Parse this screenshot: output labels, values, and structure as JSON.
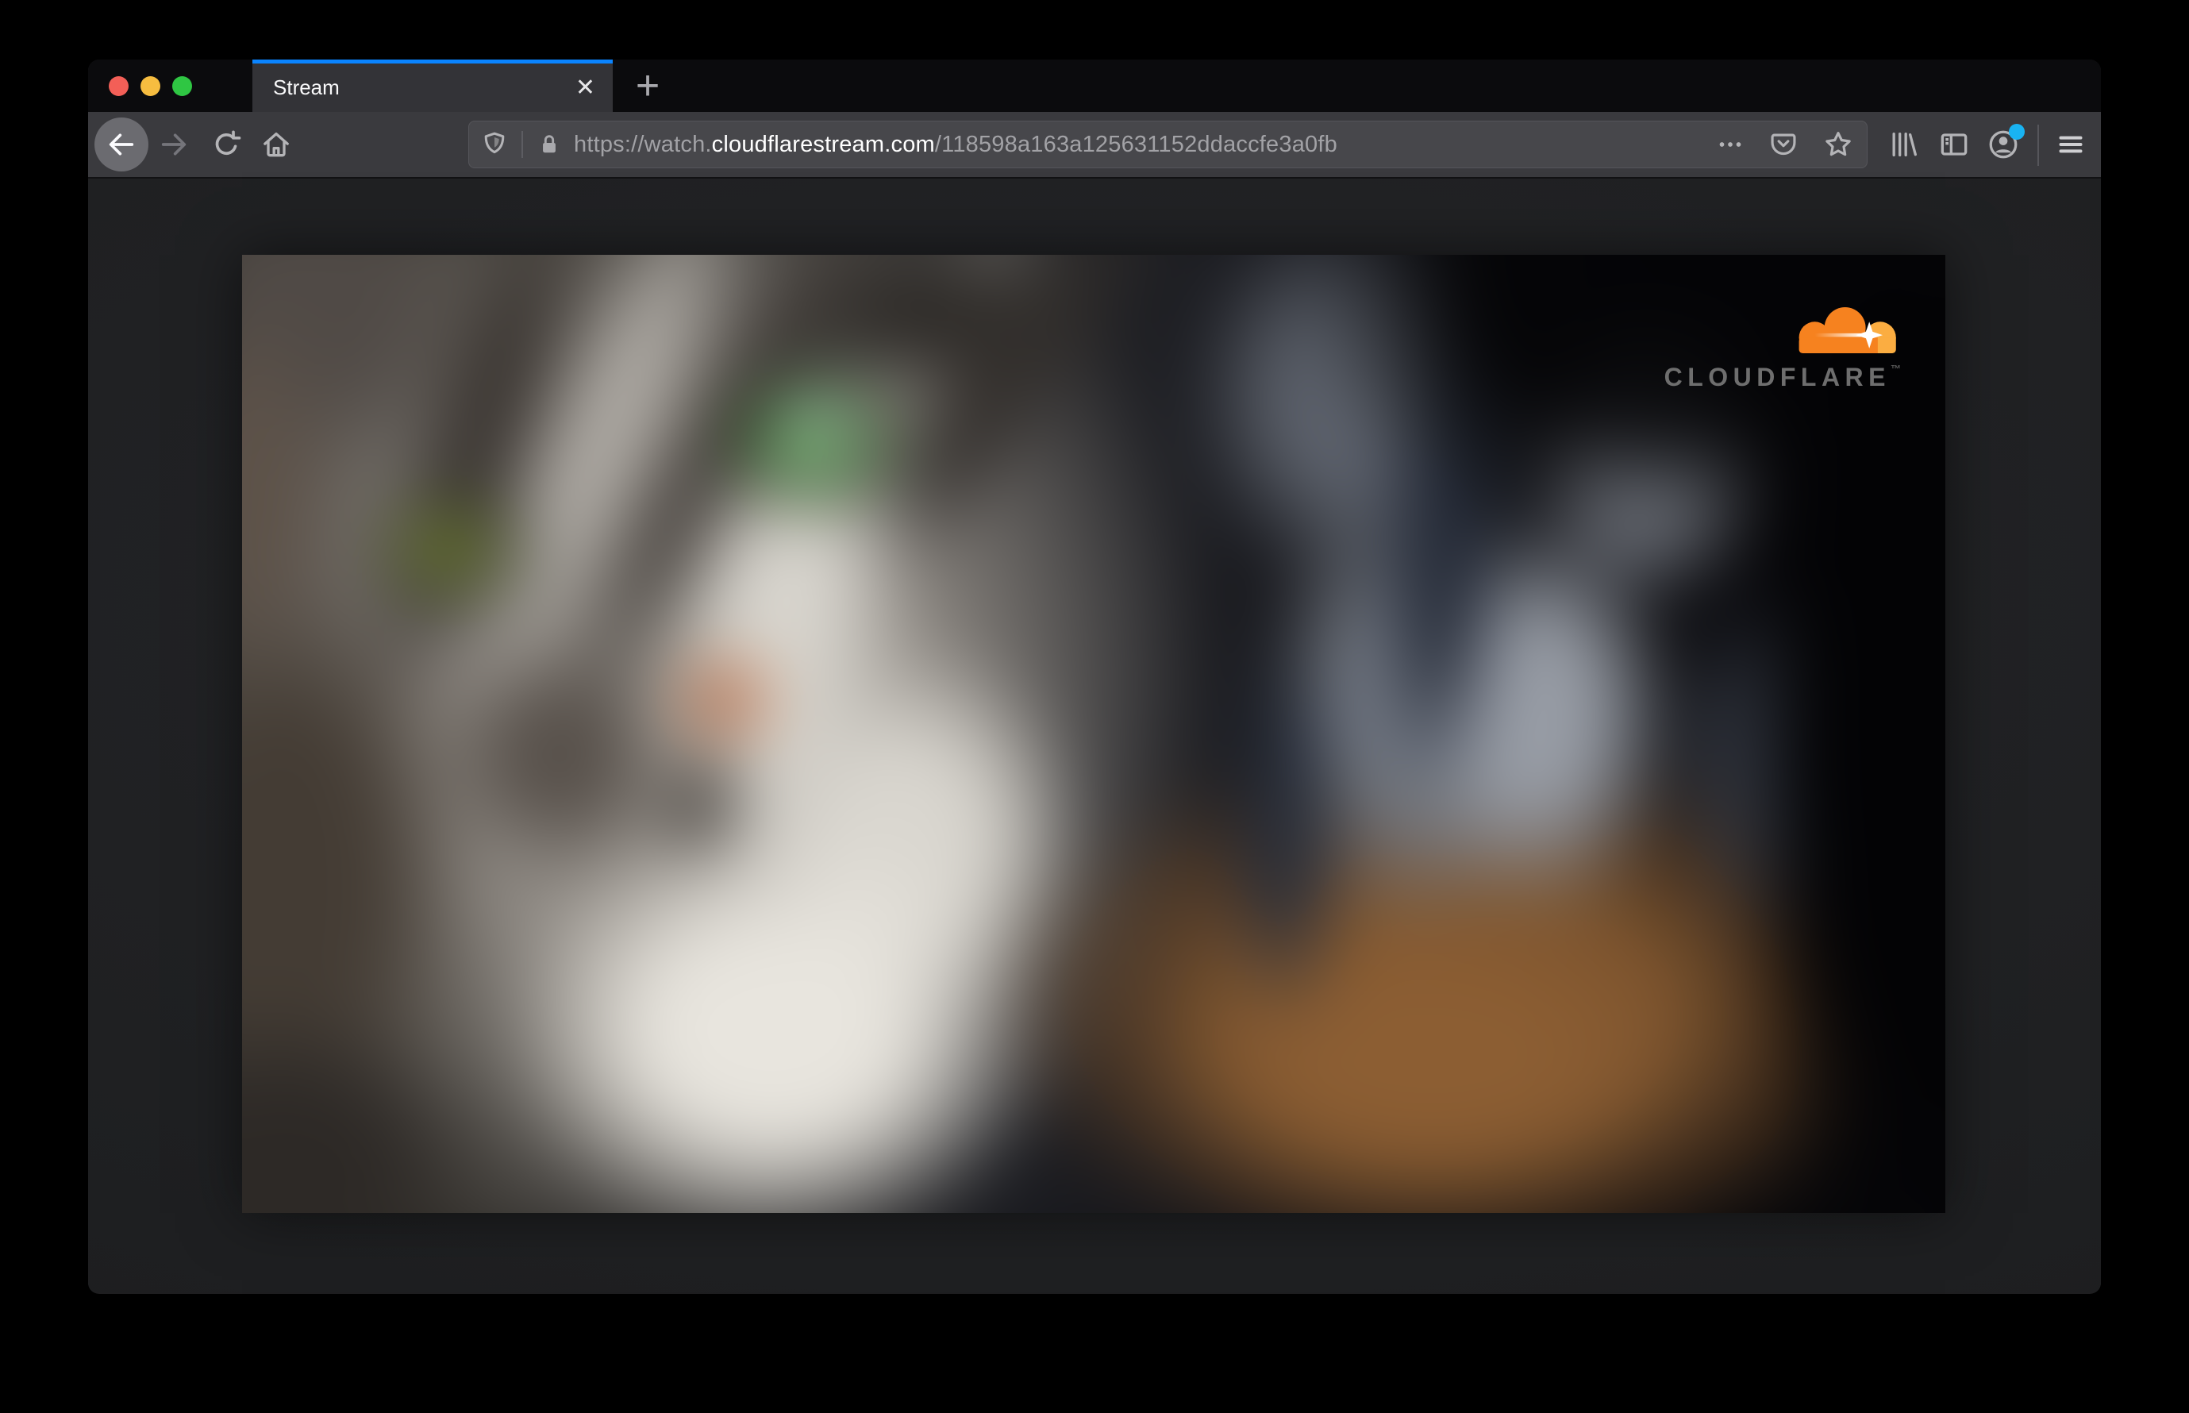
{
  "colors": {
    "accent_blue": "#0a84ff",
    "notification_blue": "#19b3f2",
    "cloudflare_orange": "#f6821f",
    "cloudflare_orange_light": "#fbad41",
    "mac_close_red": "#f35f57",
    "mac_minimize_yellow": "#f6bd40",
    "mac_zoom_green": "#2fc643"
  },
  "tab_bar": {
    "active_tab": {
      "title": "Stream",
      "close_glyph": "✕"
    },
    "new_tab_glyph": "+"
  },
  "toolbar": {
    "url_bar": {
      "url_prefix": "https://watch.",
      "url_domain": "cloudflarestream.com",
      "url_path": "/118598a163a125631152ddaccfe3a0fb"
    }
  },
  "video": {
    "brand_text": "CLOUDFLARE",
    "trademark_glyph": "™"
  }
}
